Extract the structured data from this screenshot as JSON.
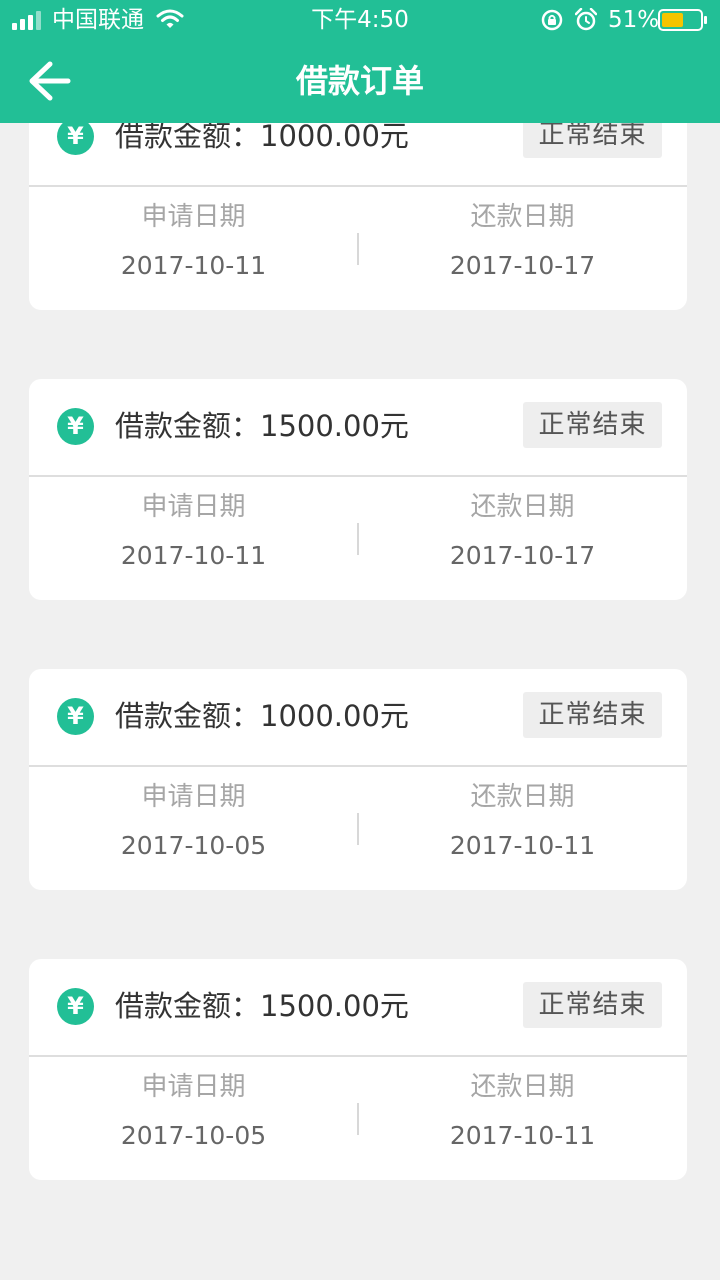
{
  "status_bar": {
    "carrier": "中国联通",
    "time": "下午4:50",
    "battery": "51%"
  },
  "header": {
    "title": "借款订单",
    "back_icon": "arrow-left-icon"
  },
  "colors": {
    "accent": "#22bf96",
    "background": "#f0f0f0",
    "badge_bg": "#eeeeee",
    "battery": "#f5c400"
  },
  "orders": [
    {
      "amount": "借款金额：1000.00元",
      "status": "正常结束",
      "apply_label": "申请日期",
      "apply_date": "2017-10-11",
      "repay_label": "还款日期",
      "repay_date": "2017-10-17"
    },
    {
      "amount": "借款金额：1500.00元",
      "status": "正常结束",
      "apply_label": "申请日期",
      "apply_date": "2017-10-11",
      "repay_label": "还款日期",
      "repay_date": "2017-10-17"
    },
    {
      "amount": "借款金额：1000.00元",
      "status": "正常结束",
      "apply_label": "申请日期",
      "apply_date": "2017-10-05",
      "repay_label": "还款日期",
      "repay_date": "2017-10-11"
    },
    {
      "amount": "借款金额：1500.00元",
      "status": "正常结束",
      "apply_label": "申请日期",
      "apply_date": "2017-10-05",
      "repay_label": "还款日期",
      "repay_date": "2017-10-11"
    }
  ]
}
